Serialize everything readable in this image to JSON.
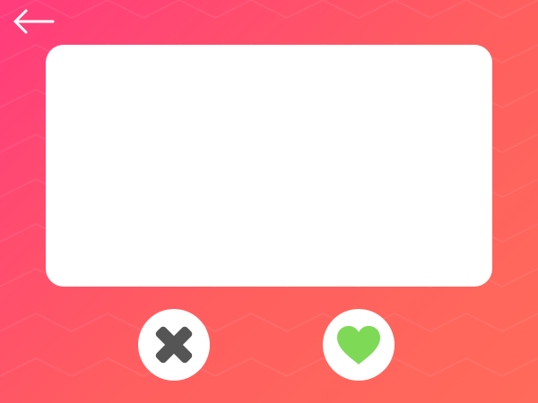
{
  "screen": {
    "gradient_start": "#ff3b7d",
    "gradient_end": "#ff6a5a"
  },
  "header": {
    "back_icon": "arrow-left-icon",
    "back_icon_color": "#ffffff"
  },
  "card": {
    "background": "#ffffff",
    "content": ""
  },
  "actions": {
    "dislike": {
      "icon": "close-icon",
      "icon_color": "#555555"
    },
    "like": {
      "icon": "heart-icon",
      "icon_color": "#7ed957"
    }
  }
}
